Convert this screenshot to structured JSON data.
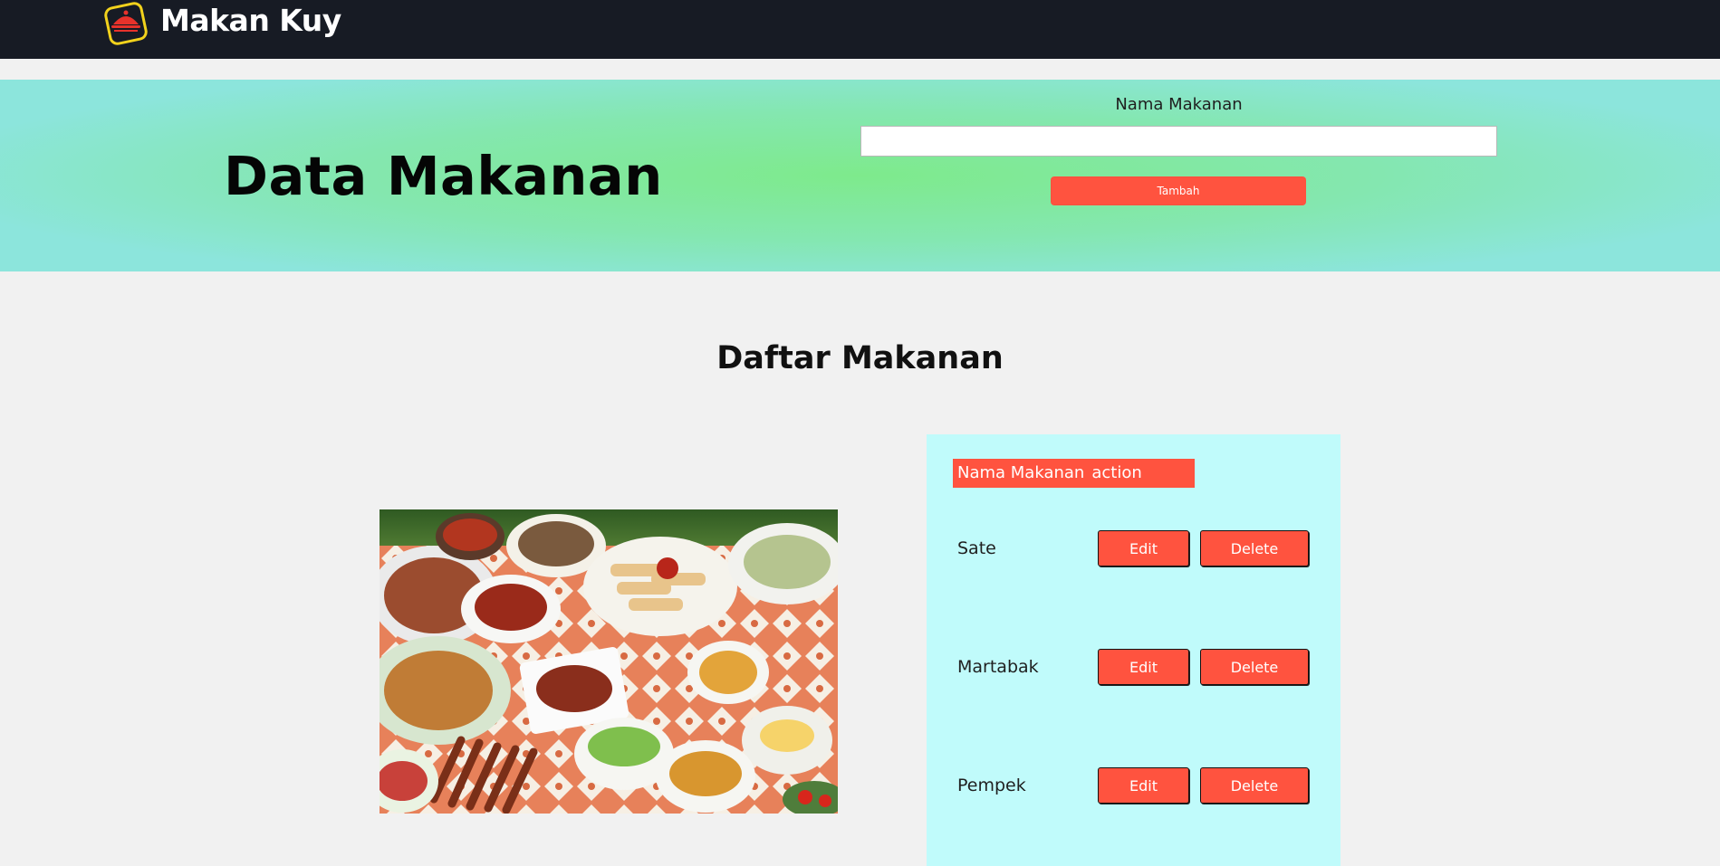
{
  "navbar": {
    "brand": "Makan Kuy",
    "logo_icon": "food-cloche-logo-icon",
    "colors": {
      "background": "#171b24",
      "logo_ring": "#f2d21c",
      "logo_dome": "#e8322b"
    }
  },
  "hero": {
    "title": "Data Makanan",
    "form": {
      "label": "Nama Makanan",
      "input_value": "",
      "input_placeholder": "",
      "submit_label": "Tambah"
    },
    "colors": {
      "gradient_center": "#7eea8c",
      "gradient_edge": "#8ce5dc"
    }
  },
  "list": {
    "title": "Daftar Makanan",
    "image_alt": "food-photo",
    "table": {
      "headers": [
        "Nama Makanan",
        "action"
      ],
      "rows": [
        {
          "name": "Sate",
          "edit_label": "Edit",
          "delete_label": "Delete"
        },
        {
          "name": "Martabak",
          "edit_label": "Edit",
          "delete_label": "Delete"
        },
        {
          "name": "Pempek",
          "edit_label": "Edit",
          "delete_label": "Delete"
        }
      ]
    },
    "colors": {
      "panel": "#c0fbfb",
      "accent": "#ff533f"
    }
  }
}
